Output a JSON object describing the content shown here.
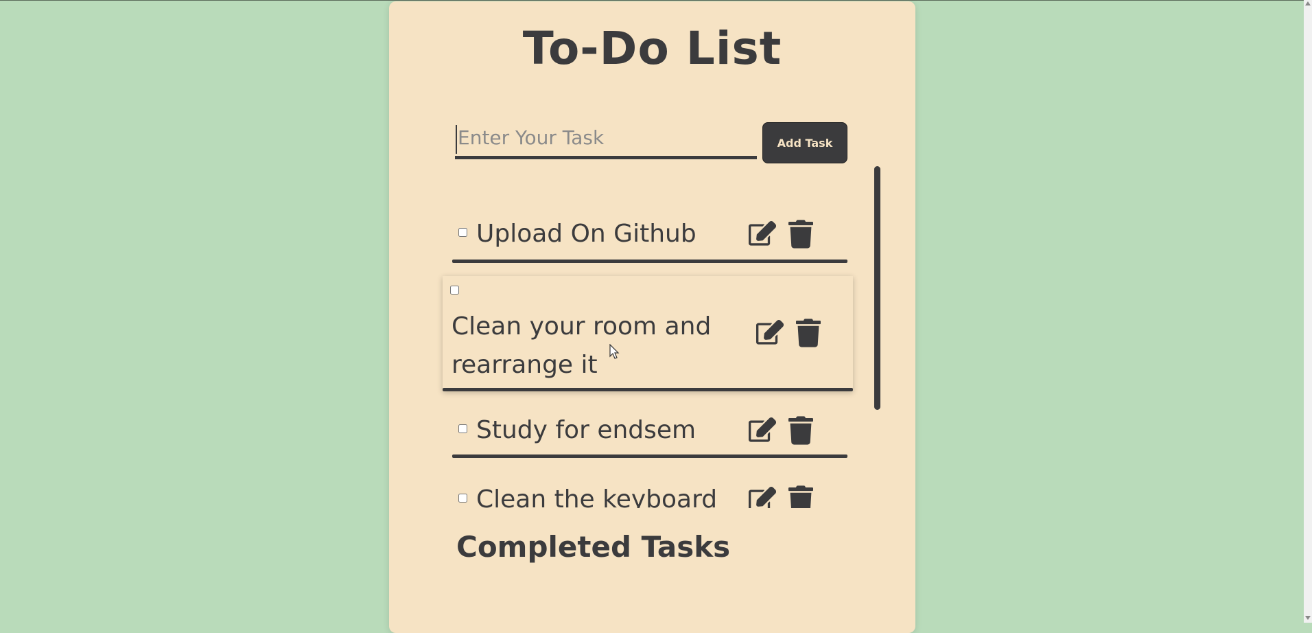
{
  "app": {
    "title": "To-Do List"
  },
  "input": {
    "placeholder": "Enter Your Task",
    "value": ""
  },
  "add_button": {
    "label": "Add Task"
  },
  "tasks": [
    {
      "label": "Upload On Github",
      "checked": false
    },
    {
      "label": "Clean your room and rearrange it",
      "checked": false
    },
    {
      "label": "Study for endsem",
      "checked": false
    },
    {
      "label": "Clean the keyboard",
      "checked": false
    }
  ],
  "icons": {
    "edit": "edit-icon",
    "delete": "trash-icon"
  },
  "completed_section": {
    "title": "Completed Tasks"
  },
  "colors": {
    "page_background": "#b9dbba",
    "card_background": "#f6e3c4",
    "text": "#3b3b3d",
    "button_background": "#3b3b3d",
    "button_text": "#f6e3c4"
  }
}
